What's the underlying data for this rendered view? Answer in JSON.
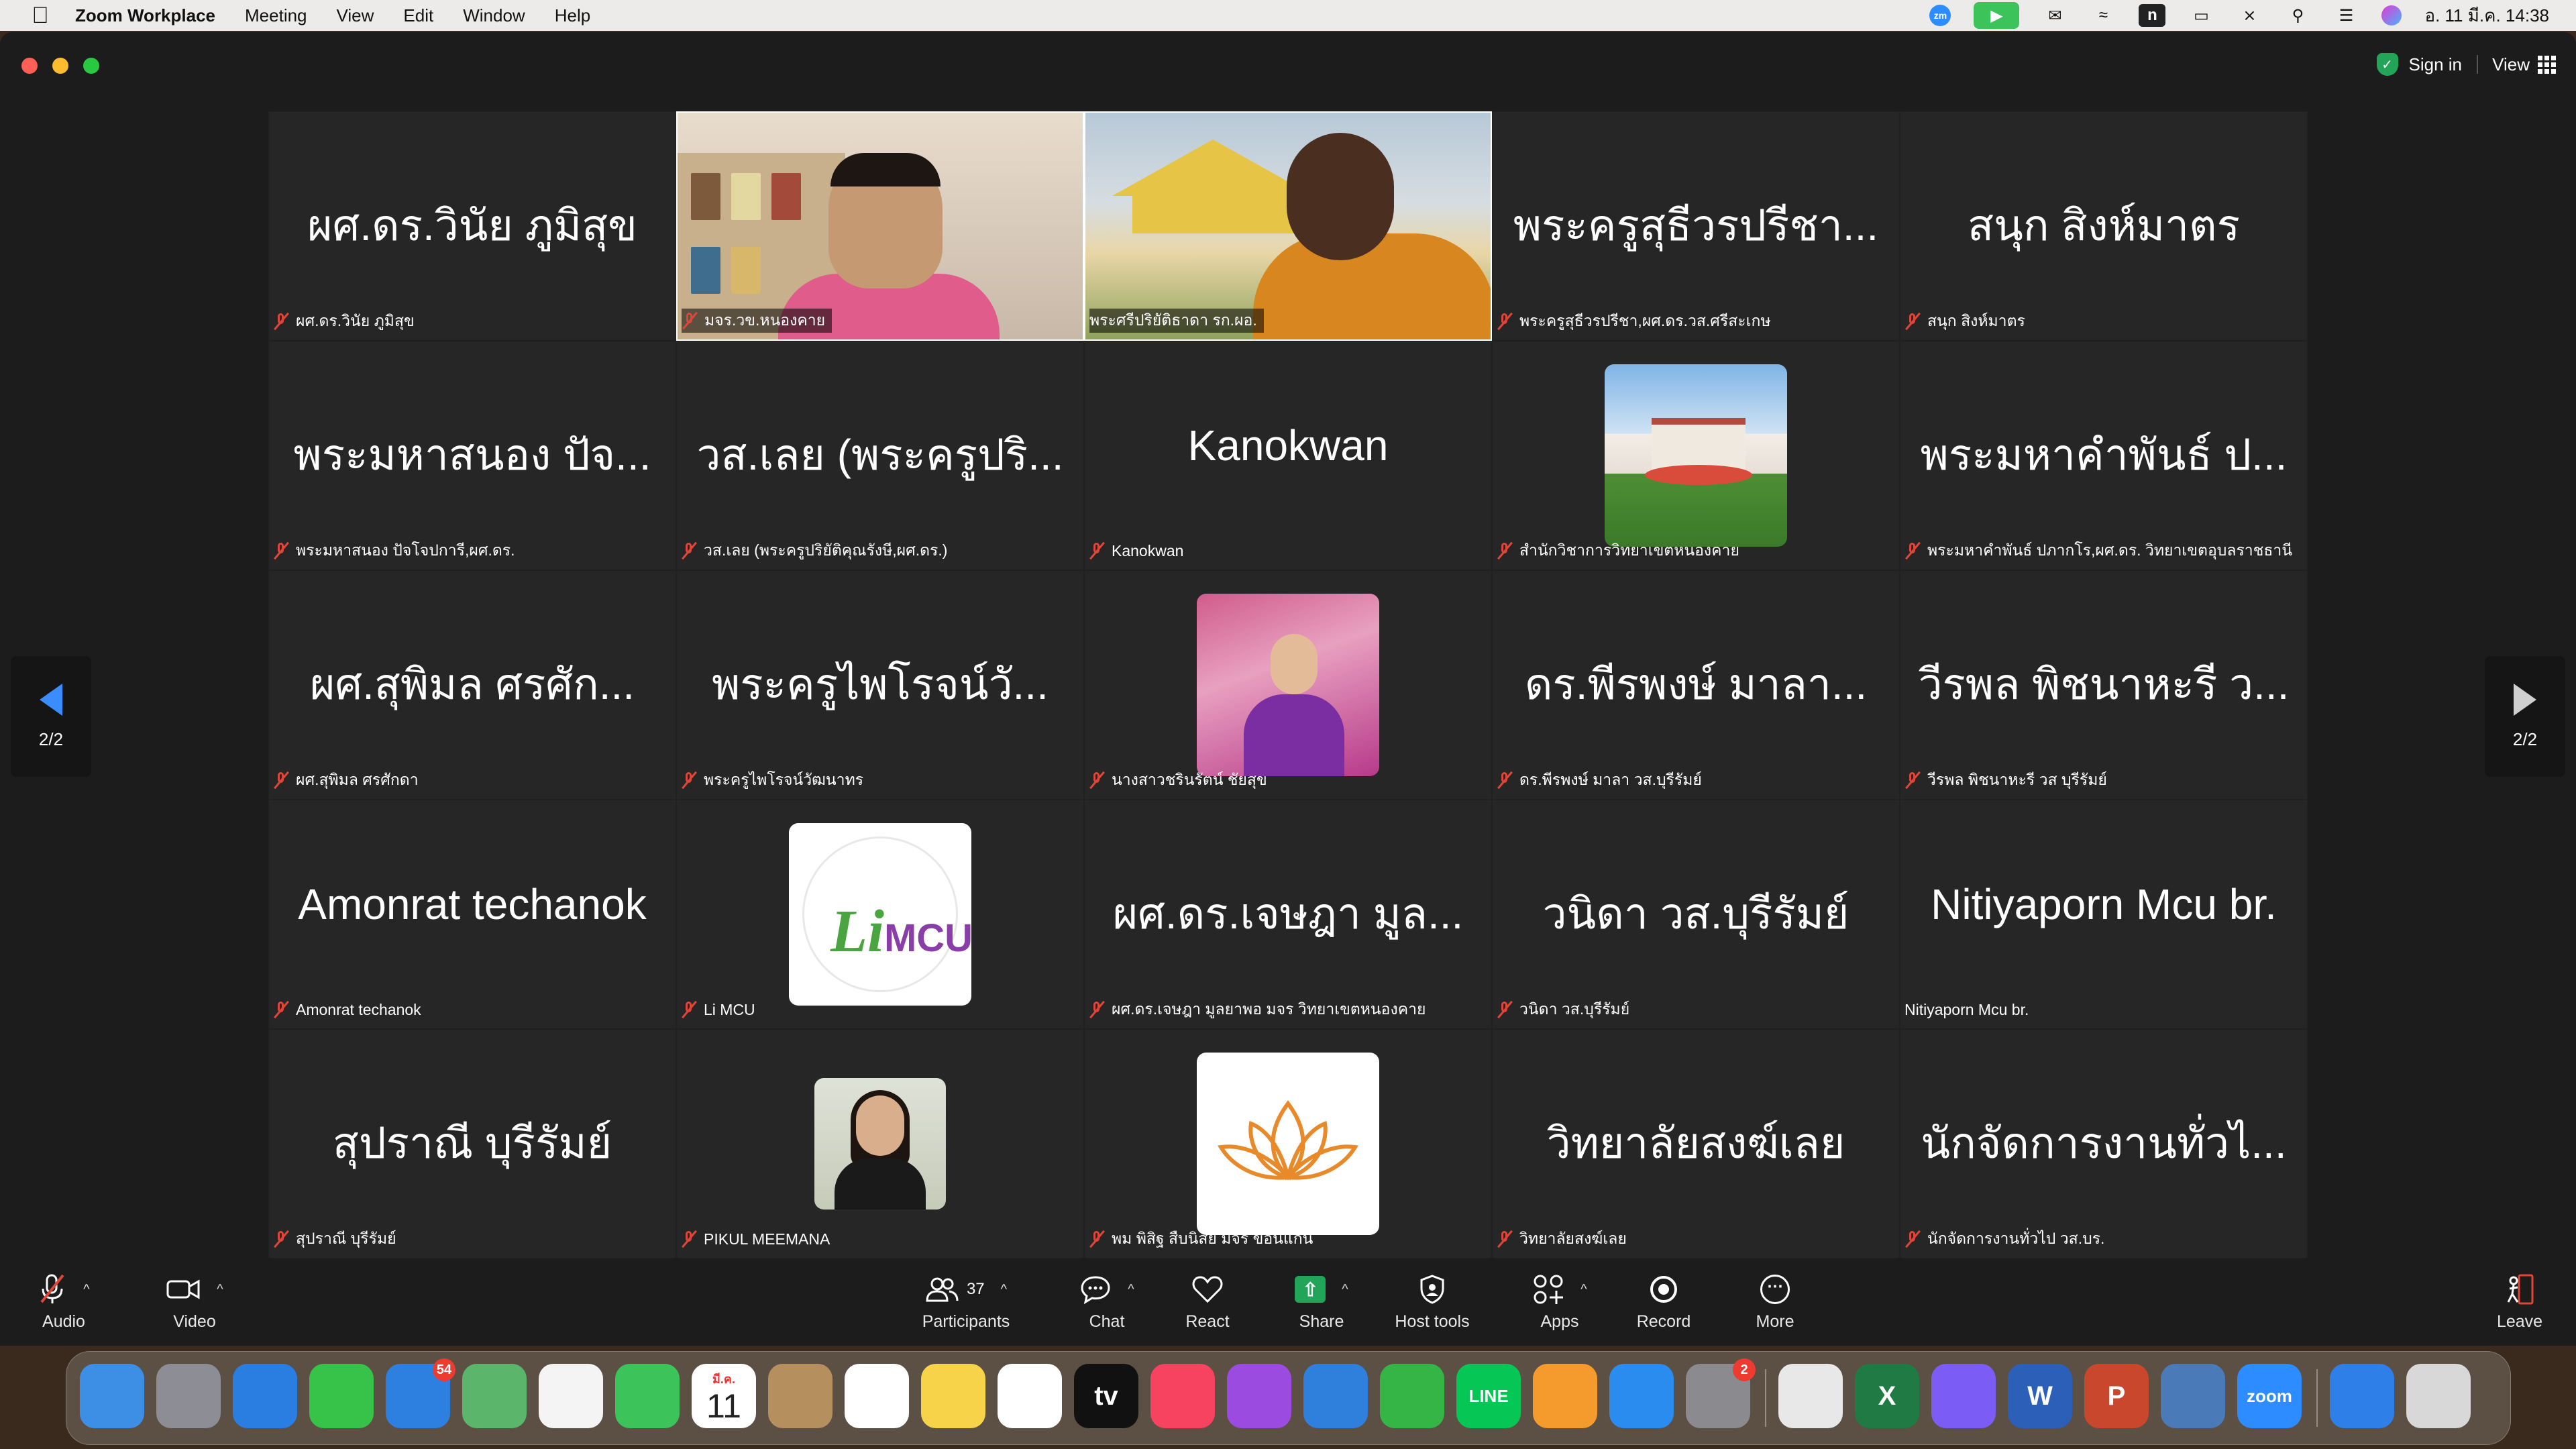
{
  "menubar": {
    "app_name": "Zoom Workplace",
    "menus": [
      "Meeting",
      "View",
      "Edit",
      "Window",
      "Help"
    ],
    "clock": "อ. 11 มี.ค.  14:38",
    "status_icons": [
      "zoom-status-icon",
      "video-status-icon",
      "line-icon",
      "wifi-icon",
      "n-icon",
      "battery-icon",
      "bluetooth-off-icon",
      "spotlight-search-icon",
      "control-center-icon",
      "siri-icon"
    ]
  },
  "window": {
    "sign_in_label": "Sign in",
    "view_label": "View"
  },
  "gallery": {
    "page_indicator": "2/2",
    "tiles": [
      {
        "display": "ผศ.ดร.วินัย ภูมิสุข",
        "name": "ผศ.ดร.วินัย ภูมิสุข",
        "muted": true,
        "type": "name"
      },
      {
        "display": "",
        "name": "มจร.วข.หนองคาย",
        "muted": true,
        "type": "video1"
      },
      {
        "display": "",
        "name": "พระศรีปริยัติธาดา รก.ผอ.",
        "muted": false,
        "type": "video2"
      },
      {
        "display": "พระครูสุธีวรปรีชา...",
        "name": "พระครูสุธีวรปรีชา,ผศ.ดร.วส.ศรีสะเกษ",
        "muted": true,
        "type": "name"
      },
      {
        "display": "สนุก สิงห์มาตร",
        "name": "สนุก สิงห์มาตร",
        "muted": true,
        "type": "name"
      },
      {
        "display": "พระมหาสนอง ปัจ...",
        "name": "พระมหาสนอง ปัจโจปการี,ผศ.ดร.",
        "muted": true,
        "type": "name"
      },
      {
        "display": "วส.เลย (พระครูปริ...",
        "name": "วส.เลย (พระครูปริยัติคุณรังษี,ผศ.ดร.)",
        "muted": true,
        "type": "name"
      },
      {
        "display": "Kanokwan",
        "name": "Kanokwan",
        "muted": true,
        "type": "name"
      },
      {
        "display": "",
        "name": "สำนักวิชาการวิทยาเขตหนองคาย",
        "muted": true,
        "type": "campus"
      },
      {
        "display": "พระมหาคำพันธ์ ป...",
        "name": "พระมหาคำพันธ์ ปภากโร,ผศ.ดร. วิทยาเขตอุบลราชธานี",
        "muted": true,
        "type": "name"
      },
      {
        "display": "ผศ.สุพิมล  ศรศัก...",
        "name": "ผศ.สุพิมล  ศรศักดา",
        "muted": true,
        "type": "name"
      },
      {
        "display": "พระครูไพโรจน์วั...",
        "name": "พระครูไพโรจน์วัฒนาทร",
        "muted": true,
        "type": "name"
      },
      {
        "display": "",
        "name": "นางสาวชรินรัตน์  ชัยสุข",
        "muted": true,
        "type": "woman"
      },
      {
        "display": "ดร.พีรพงษ์  มาลา...",
        "name": "ดร.พีรพงษ์  มาลา วส.บุรีรัมย์",
        "muted": true,
        "type": "name"
      },
      {
        "display": "วีรพล พิชนาหะรี ว...",
        "name": "วีรพล พิชนาหะรี วส บุรีรัมย์",
        "muted": true,
        "type": "name"
      },
      {
        "display": "Amonrat techanok",
        "name": "Amonrat techanok",
        "muted": true,
        "type": "name"
      },
      {
        "display": "",
        "name": "Li MCU",
        "muted": true,
        "type": "limcu",
        "logo_text": "MCU",
        "logo_letter": "Li"
      },
      {
        "display": "ผศ.ดร.เจษฎา มูล...",
        "name": "ผศ.ดร.เจษฎา มูลยาพอ  มจร วิทยาเขตหนองคาย",
        "muted": true,
        "type": "name"
      },
      {
        "display": "วนิดา วส.บุรีรัมย์",
        "name": "วนิดา วส.บุรีรัมย์",
        "muted": true,
        "type": "name"
      },
      {
        "display": "Nitiyaporn Mcu br.",
        "name": "Nitiyaporn Mcu br.",
        "muted": false,
        "type": "name"
      },
      {
        "display": "สุปราณี บุรีรัมย์",
        "name": "สุปราณี บุรีรัมย์",
        "muted": true,
        "type": "name"
      },
      {
        "display": "",
        "name": "PIKUL MEEMANA",
        "muted": true,
        "type": "pikul"
      },
      {
        "display": "",
        "name": "พม พิสิฐ สืบนิสัย มจร ขอนแก่น",
        "muted": true,
        "type": "lotus"
      },
      {
        "display": "วิทยาลัยสงฆ์เลย",
        "name": "วิทยาลัยสงฆ์เลย",
        "muted": true,
        "type": "name"
      },
      {
        "display": "นักจัดการงานทั่วไ...",
        "name": "นักจัดการงานทั่วไป วส.บร.",
        "muted": true,
        "type": "name"
      }
    ]
  },
  "toolbar": {
    "audio": "Audio",
    "video": "Video",
    "participants": "Participants",
    "participants_count": "37",
    "chat": "Chat",
    "react": "React",
    "share": "Share",
    "host_tools": "Host tools",
    "apps": "Apps",
    "record": "Record",
    "more": "More",
    "leave": "Leave"
  },
  "dock": {
    "apps": [
      {
        "name": "finder",
        "color": "#3d8fe6"
      },
      {
        "name": "launchpad",
        "color": "#8d8d95"
      },
      {
        "name": "safari",
        "color": "#2a7de1"
      },
      {
        "name": "messages",
        "color": "#37c24a"
      },
      {
        "name": "mail",
        "color": "#2d7fe0",
        "badge": "54"
      },
      {
        "name": "maps",
        "color": "#5bb56a"
      },
      {
        "name": "photos",
        "color": "#f4f4f4"
      },
      {
        "name": "facetime",
        "color": "#3cc35a"
      },
      {
        "name": "calendar",
        "color": "#ffffff",
        "text": "11",
        "month": "มี.ค."
      },
      {
        "name": "contacts",
        "color": "#b58f5e"
      },
      {
        "name": "reminders",
        "color": "#ffffff"
      },
      {
        "name": "notes",
        "color": "#f7d34a"
      },
      {
        "name": "freeform",
        "color": "#ffffff"
      },
      {
        "name": "apple-tv",
        "color": "#111111",
        "text": "tv"
      },
      {
        "name": "music",
        "color": "#f7435f"
      },
      {
        "name": "podcasts",
        "color": "#9b4be0"
      },
      {
        "name": "keynote",
        "color": "#2f7fdc"
      },
      {
        "name": "numbers",
        "color": "#34b545"
      },
      {
        "name": "line",
        "color": "#06c755",
        "text": "LINE"
      },
      {
        "name": "pages",
        "color": "#f59b2e"
      },
      {
        "name": "app-store",
        "color": "#2b8cf0"
      },
      {
        "name": "system-settings",
        "color": "#8a8a8f",
        "badge": "2"
      },
      {
        "name": "script-editor",
        "color": "#e8e8e8"
      },
      {
        "name": "excel",
        "color": "#1f7a43",
        "text": "X"
      },
      {
        "name": "messenger",
        "color": "#7b5cf5"
      },
      {
        "name": "word",
        "color": "#2b5fb8",
        "text": "W"
      },
      {
        "name": "powerpoint",
        "color": "#c9472d",
        "text": "P"
      },
      {
        "name": "preview",
        "color": "#4a7ab7"
      },
      {
        "name": "zoom",
        "color": "#2d8cff",
        "text": "zoom"
      },
      {
        "name": "downloads-folder",
        "color": "#2f7fe8"
      },
      {
        "name": "trash",
        "color": "#d8d8d8"
      }
    ]
  }
}
